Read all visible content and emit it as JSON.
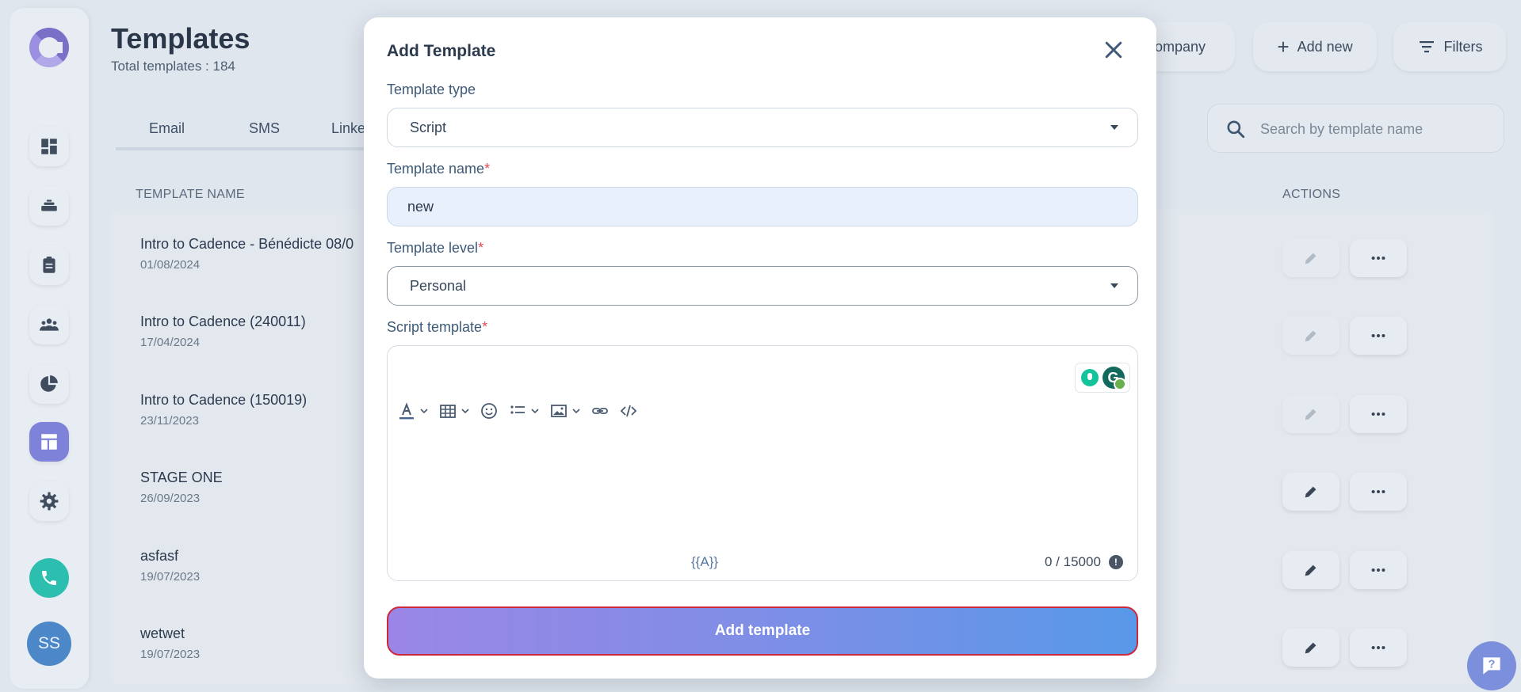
{
  "page": {
    "title": "Templates",
    "subtitle": "Total templates : 184"
  },
  "tabs": [
    "Email",
    "SMS",
    "Linke"
  ],
  "top_actions": {
    "company_label": "ompany",
    "add_new_label": "Add new",
    "filters_label": "Filters"
  },
  "search": {
    "placeholder": "Search by template name"
  },
  "table": {
    "headers": {
      "name": "TEMPLATE NAME",
      "actions": "ACTIONS"
    },
    "rows": [
      {
        "name": "Intro to Cadence - Bénédicte 08/0",
        "date": "01/08/2024"
      },
      {
        "name": "Intro to Cadence (240011)",
        "date": "17/04/2024"
      },
      {
        "name": "Intro to Cadence (150019)",
        "date": "23/11/2023"
      },
      {
        "name": "STAGE ONE",
        "date": "26/09/2023"
      },
      {
        "name": "asfasf",
        "date": "19/07/2023"
      },
      {
        "name": "wetwet",
        "date": "19/07/2023"
      }
    ]
  },
  "user": {
    "initials": "SS"
  },
  "modal": {
    "title": "Add Template",
    "template_type": {
      "label": "Template type",
      "value": "Script"
    },
    "template_name": {
      "label": "Template name",
      "value": "new"
    },
    "template_level": {
      "label": "Template level",
      "value": "Personal"
    },
    "script_template": {
      "label": "Script template",
      "variable_token": "{{A}}",
      "counter": "0 / 15000"
    },
    "required_mark": "*",
    "submit_label": "Add template"
  },
  "colors": {
    "accent": "#7e82d8",
    "required": "#e24b57",
    "call": "#2cbfb0",
    "submit_start": "#9a86e6",
    "submit_end": "#5898e8"
  }
}
